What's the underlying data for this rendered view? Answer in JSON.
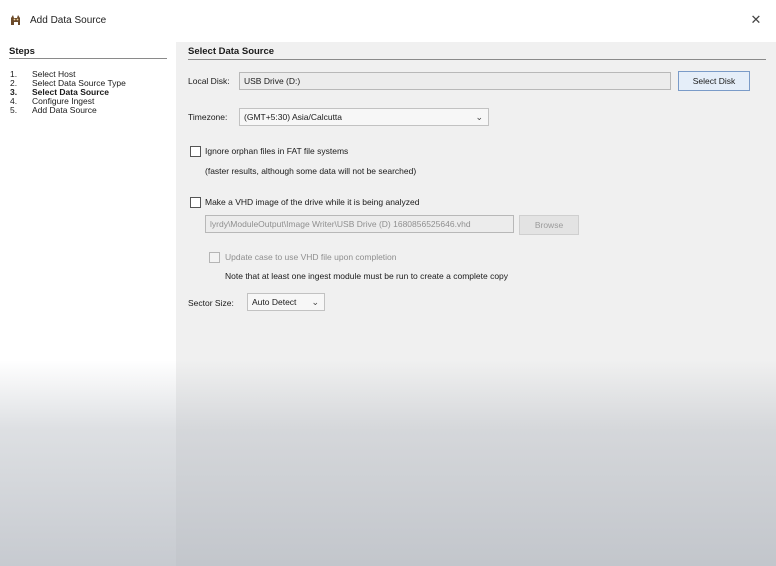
{
  "window": {
    "title": "Add Data Source",
    "close_glyph": "✕"
  },
  "steps": {
    "heading": "Steps",
    "items": [
      {
        "num": "1.",
        "label": "Select Host"
      },
      {
        "num": "2.",
        "label": "Select Data Source Type"
      },
      {
        "num": "3.",
        "label": "Select Data Source"
      },
      {
        "num": "4.",
        "label": "Configure Ingest"
      },
      {
        "num": "5.",
        "label": "Add Data Source"
      }
    ],
    "current_index": 2
  },
  "form": {
    "heading": "Select Data Source",
    "local_disk": {
      "label": "Local Disk:",
      "value": "USB Drive (D:)",
      "button": "Select Disk"
    },
    "timezone": {
      "label": "Timezone:",
      "value": "(GMT+5:30) Asia/Calcutta"
    },
    "ignore_orphan": {
      "label": "Ignore orphan files in FAT file systems",
      "note": "(faster results, although some data will not be searched)",
      "checked": false
    },
    "vhd": {
      "label": "Make a VHD image of the drive while it is being analyzed",
      "path": "lyrdy\\ModuleOutput\\Image Writer\\USB Drive (D) 1680856525646.vhd",
      "browse": "Browse",
      "checked": false,
      "update_case_label": "Update case to use VHD file upon completion",
      "note": "Note that at least one ingest module must be run to create a complete copy"
    },
    "sector_size": {
      "label": "Sector Size:",
      "value": "Auto Detect"
    }
  },
  "icons": {
    "app": "autopsy-dog-icon",
    "close": "close-icon",
    "dropdown": "chevron-down-icon"
  }
}
